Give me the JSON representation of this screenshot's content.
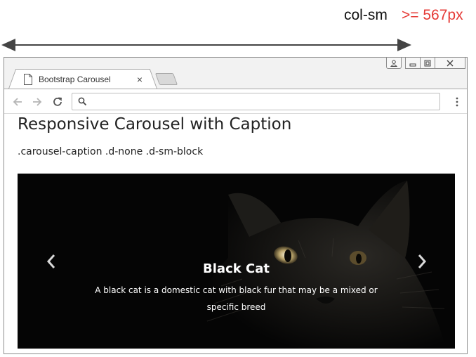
{
  "annotation": {
    "breakpoint_label": "col-sm",
    "breakpoint_value": ">= 567px"
  },
  "browser": {
    "tab_title": "Bootstrap Carousel",
    "tab_close": "×",
    "address_value": "",
    "icons": [
      "profile-icon",
      "minimize-icon",
      "maximize-icon",
      "close-icon",
      "page-icon",
      "back-arrow-icon",
      "forward-arrow-icon",
      "reload-icon",
      "search-icon",
      "kebab-menu-icon"
    ]
  },
  "page": {
    "title": "Responsive Carousel with Caption",
    "subtitle": ".carousel-caption .d-none .d-sm-block"
  },
  "carousel": {
    "slide_title": "Black Cat",
    "slide_text": "A black cat is a domestic cat with black fur that may be a mixed or specific breed",
    "prev_icon": "chevron-left-icon",
    "next_icon": "chevron-right-icon"
  },
  "colors": {
    "accent_red": "#e53935",
    "carousel_bg": "#050505"
  }
}
